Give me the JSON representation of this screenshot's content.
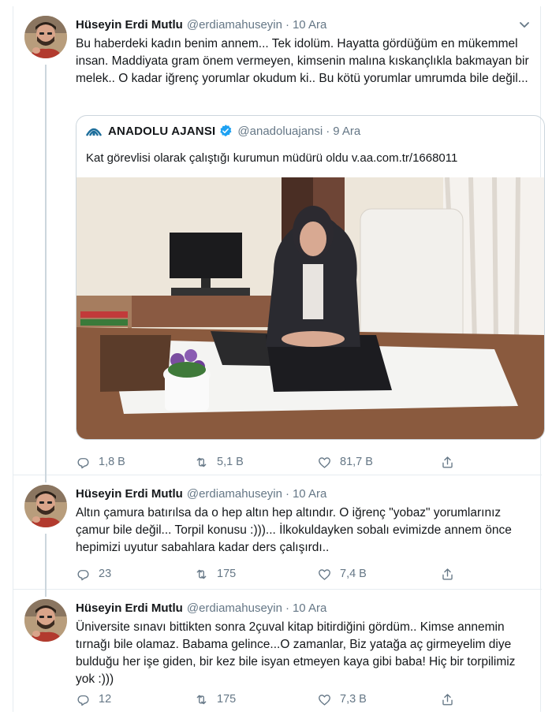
{
  "tweets": [
    {
      "name": "Hüseyin Erdi Mutlu",
      "handle": "@erdiamahuseyin",
      "separator": "·",
      "time": "10 Ara",
      "text": "Bu haberdeki kadın benim annem... Tek idolüm. Hayatta gördüğüm en mükemmel insan. Maddiyata gram önem vermeyen, kimsenin malına kıskançlıkla bakmayan bir melek.. O kadar iğrenç yorumlar okudum ki.. Bu kötü yorumlar umrumda bile değil...",
      "quote": {
        "name": "ANADOLU AJANSI",
        "handle": "@anadoluajansi",
        "separator": "·",
        "time": "9 Ara",
        "text": "Kat görevlisi olarak çalıştığı kurumun müdürü oldu v.aa.com.tr/1668011"
      },
      "replies": "1,8 B",
      "retweets": "5,1 B",
      "likes": "81,7 B"
    },
    {
      "name": "Hüseyin Erdi Mutlu",
      "handle": "@erdiamahuseyin",
      "separator": "·",
      "time": "10 Ara",
      "text": "Altın çamura batırılsa da o hep altın hep altındır. O iğrenç \"yobaz\" yorumlarınız çamur bile değil... Torpil konusu :)))... İlkokuldayken sobalı evimizde annem önce hepimizi uyutur sabahlara kadar ders çalışırdı..",
      "replies": "23",
      "retweets": "175",
      "likes": "7,4 B"
    },
    {
      "name": "Hüseyin Erdi Mutlu",
      "handle": "@erdiamahuseyin",
      "separator": "·",
      "time": "10 Ara",
      "text": "Üniversite sınavı bittikten sonra 2çuval kitap bitirdiğini gördüm.. Kimse annemin tırnağı bile olamaz. Babama gelince...O zamanlar, Biz yatağa aç girmeyelim diye bulduğu her işe giden, bir kez bile isyan etmeyen kaya gibi baba! Hiç bir torpilimiz yok :)))",
      "replies": "12",
      "retweets": "175",
      "likes": "7,3 B"
    }
  ],
  "colors": {
    "text": "#14171a",
    "secondary": "#657786",
    "border": "#e6ecf0",
    "verified": "#1da1f2"
  },
  "icons": [
    "reply-icon",
    "retweet-icon",
    "like-icon",
    "share-icon",
    "chevron-down-icon",
    "verified-icon"
  ]
}
